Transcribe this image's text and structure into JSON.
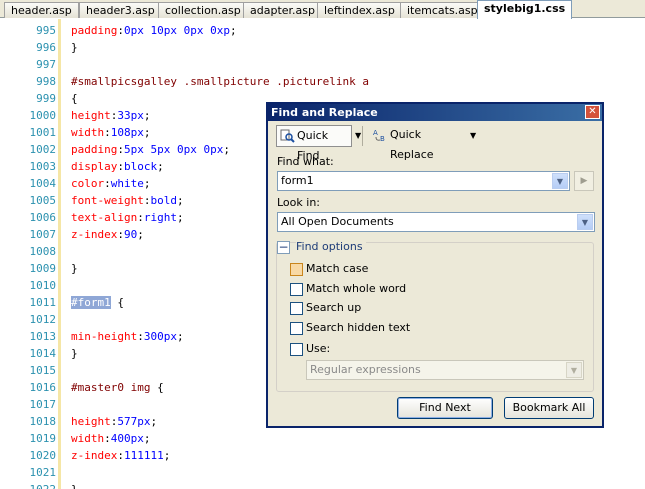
{
  "tabs": [
    {
      "label": "header.asp",
      "active": false
    },
    {
      "label": "header3.asp",
      "active": false
    },
    {
      "label": "collection.asp",
      "active": false
    },
    {
      "label": "adapter.asp",
      "active": false
    },
    {
      "label": "leftindex.asp",
      "active": false
    },
    {
      "label": "itemcats.asp",
      "active": false
    },
    {
      "label": "stylebig1.css",
      "active": true
    }
  ],
  "editor": {
    "lines": [
      {
        "n": "995",
        "parts": [
          [
            "prop",
            "padding"
          ],
          [
            "punc",
            ":"
          ],
          [
            "val",
            "0px 10px 0px 0xp"
          ],
          [
            "punc",
            ";"
          ]
        ]
      },
      {
        "n": "996",
        "parts": [
          [
            "punc",
            "}"
          ]
        ]
      },
      {
        "n": "997",
        "parts": []
      },
      {
        "n": "998",
        "parts": [
          [
            "sel",
            "#smallpicsgalley .smallpicture .picturelink a"
          ]
        ]
      },
      {
        "n": "999",
        "parts": [
          [
            "punc",
            "{"
          ]
        ]
      },
      {
        "n": "1000",
        "parts": [
          [
            "prop",
            "height"
          ],
          [
            "punc",
            ":"
          ],
          [
            "val",
            "33px"
          ],
          [
            "punc",
            ";"
          ]
        ]
      },
      {
        "n": "1001",
        "parts": [
          [
            "prop",
            "width"
          ],
          [
            "punc",
            ":"
          ],
          [
            "val",
            "108px"
          ],
          [
            "punc",
            ";"
          ]
        ]
      },
      {
        "n": "1002",
        "parts": [
          [
            "prop",
            "padding"
          ],
          [
            "punc",
            ":"
          ],
          [
            "val",
            "5px 5px 0px 0px"
          ],
          [
            "punc",
            ";"
          ]
        ]
      },
      {
        "n": "1003",
        "parts": [
          [
            "prop",
            "display"
          ],
          [
            "punc",
            ":"
          ],
          [
            "val",
            "block"
          ],
          [
            "punc",
            ";"
          ]
        ]
      },
      {
        "n": "1004",
        "parts": [
          [
            "prop",
            "color"
          ],
          [
            "punc",
            ":"
          ],
          [
            "val",
            "white"
          ],
          [
            "punc",
            ";"
          ]
        ]
      },
      {
        "n": "1005",
        "parts": [
          [
            "prop",
            "font-weight"
          ],
          [
            "punc",
            ":"
          ],
          [
            "val",
            "bold"
          ],
          [
            "punc",
            ";"
          ]
        ]
      },
      {
        "n": "1006",
        "parts": [
          [
            "prop",
            "text-align"
          ],
          [
            "punc",
            ":"
          ],
          [
            "val",
            "right"
          ],
          [
            "punc",
            ";"
          ]
        ]
      },
      {
        "n": "1007",
        "parts": [
          [
            "prop",
            "z-index"
          ],
          [
            "punc",
            ":"
          ],
          [
            "val",
            "90"
          ],
          [
            "punc",
            ";"
          ]
        ]
      },
      {
        "n": "1008",
        "parts": []
      },
      {
        "n": "1009",
        "parts": [
          [
            "punc",
            "}"
          ]
        ]
      },
      {
        "n": "1010",
        "parts": []
      },
      {
        "n": "1011",
        "parts": [
          [
            "hl",
            "#form1"
          ],
          [
            "punc",
            " {"
          ]
        ]
      },
      {
        "n": "1012",
        "parts": []
      },
      {
        "n": "1013",
        "parts": [
          [
            "prop",
            "min-height"
          ],
          [
            "punc",
            ":"
          ],
          [
            "val",
            "300px"
          ],
          [
            "punc",
            ";"
          ]
        ]
      },
      {
        "n": "1014",
        "parts": [
          [
            "punc",
            "}"
          ]
        ]
      },
      {
        "n": "1015",
        "parts": []
      },
      {
        "n": "1016",
        "parts": [
          [
            "sel",
            "#master0 img"
          ],
          [
            "punc",
            " {"
          ]
        ]
      },
      {
        "n": "1017",
        "parts": []
      },
      {
        "n": "1018",
        "parts": [
          [
            "prop",
            "height"
          ],
          [
            "punc",
            ":"
          ],
          [
            "val",
            "577px"
          ],
          [
            "punc",
            ";"
          ]
        ]
      },
      {
        "n": "1019",
        "parts": [
          [
            "prop",
            "width"
          ],
          [
            "punc",
            ":"
          ],
          [
            "val",
            "400px"
          ],
          [
            "punc",
            ";"
          ]
        ]
      },
      {
        "n": "1020",
        "parts": [
          [
            "prop",
            "z-index"
          ],
          [
            "punc",
            ":"
          ],
          [
            "val",
            "111111"
          ],
          [
            "punc",
            ";"
          ]
        ]
      },
      {
        "n": "1021",
        "parts": []
      },
      {
        "n": "1022",
        "parts": [
          [
            "punc",
            "}"
          ]
        ]
      }
    ]
  },
  "dialog": {
    "title": "Find and Replace",
    "close_glyph": "✕",
    "quick_find_label": "Quick Find",
    "quick_replace_label": "Quick Replace",
    "find_what_label": "Find what:",
    "find_what_value": "form1",
    "look_in_label": "Look in:",
    "look_in_value": "All Open Documents",
    "find_options_label": "Find options",
    "options": [
      {
        "label": "Match case",
        "checked": false
      },
      {
        "label": "Match whole word",
        "checked": false
      },
      {
        "label": "Search up",
        "checked": false
      },
      {
        "label": "Search hidden text",
        "checked": false
      },
      {
        "label": "Use:",
        "checked": false
      }
    ],
    "use_value": "Regular expressions",
    "find_next_label": "Find Next",
    "bookmark_all_label": "Bookmark All"
  },
  "colors": {
    "property": "#ff0000",
    "value": "#0000ff",
    "selector": "#800000",
    "line_number": "#2b91af",
    "highlight": "#8fa7d6",
    "title_bar": "#0a246a"
  }
}
